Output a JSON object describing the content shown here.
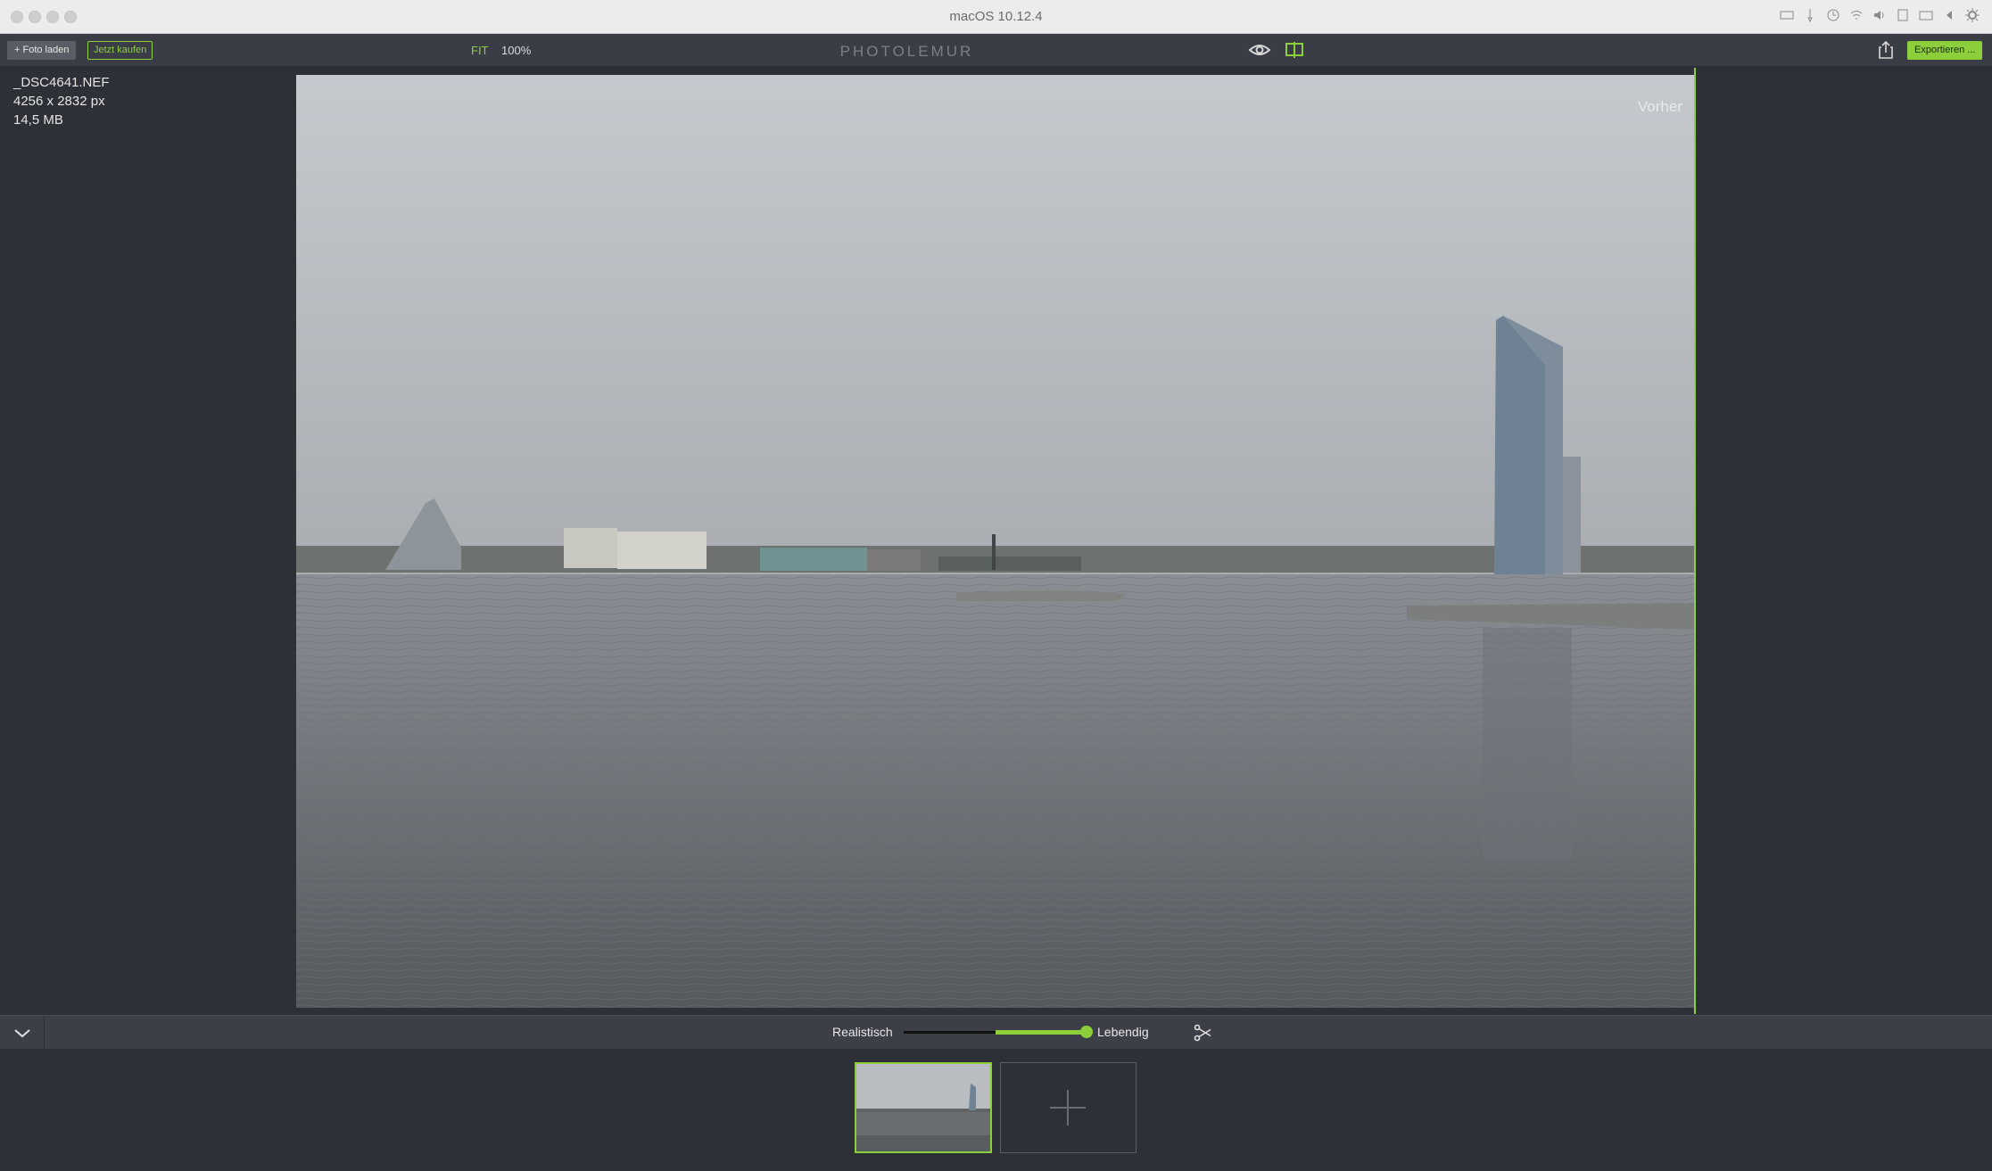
{
  "window": {
    "title": "macOS 10.12.4"
  },
  "toolbar": {
    "load_label": "+ Foto laden",
    "buy_label": "Jetzt kaufen",
    "fit_label": "FIT",
    "zoom_label": "100%",
    "brand": "PHOTOLEMUR",
    "export_label": "Exportieren ..."
  },
  "file_info": {
    "filename": "_DSC4641.NEF",
    "dimensions": "4256 x 2832  px",
    "size": "14,5 MB"
  },
  "preview": {
    "before_label": "Vorher"
  },
  "enhance": {
    "left_label": "Realistisch",
    "right_label": "Lebendig",
    "level": 1.0,
    "start": 0.5
  },
  "colors": {
    "accent": "#8ccf3b",
    "panel": "#2e3038",
    "toolbar": "#3a3d46"
  },
  "icons": [
    "eye-icon",
    "split-compare-icon",
    "share-icon",
    "chevron-down-icon",
    "fork-icon",
    "plus-icon"
  ]
}
